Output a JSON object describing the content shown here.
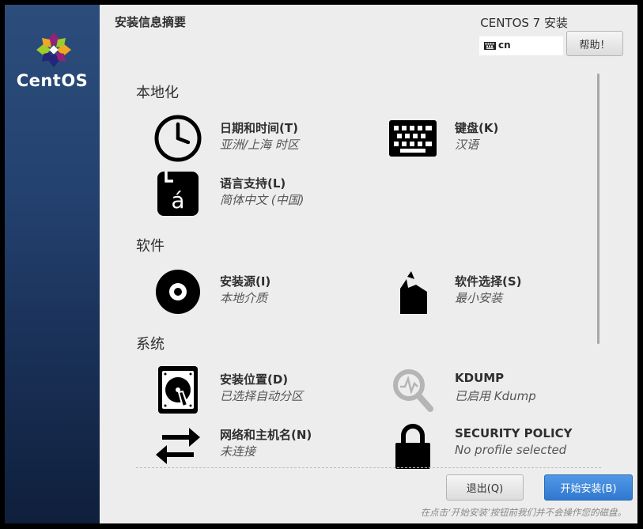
{
  "brand": {
    "name": "CentOS"
  },
  "header": {
    "title": "安装信息摘要",
    "install_title": "CENTOS 7 安装",
    "keyboard_layout": "cn",
    "help_label": "帮助！"
  },
  "sections": {
    "localization": "本地化",
    "software": "软件",
    "system": "系统"
  },
  "spokes": {
    "datetime": {
      "title": "日期和时间(T)",
      "status": "亚洲/上海 时区"
    },
    "keyboard": {
      "title": "键盘(K)",
      "status": "汉语"
    },
    "language": {
      "title": "语言支持(L)",
      "status": "简体中文 (中国)"
    },
    "source": {
      "title": "安装源(I)",
      "status": "本地介质"
    },
    "software_selection": {
      "title": "软件选择(S)",
      "status": "最小安装"
    },
    "destination": {
      "title": "安装位置(D)",
      "status": "已选择自动分区"
    },
    "kdump": {
      "title": "KDUMP",
      "status": "已启用 Kdump"
    },
    "network": {
      "title": "网络和主机名(N)",
      "status": "未连接"
    },
    "security": {
      "title": "SECURITY POLICY",
      "status": "No profile selected"
    }
  },
  "footer": {
    "quit_label": "退出(Q)",
    "begin_label": "开始安装(B)",
    "note": "在点击‘开始安装’按钮前我们并不会操作您的磁盘。"
  },
  "colors": {
    "sidebar": "#244270",
    "primary_button": "#3a83d8",
    "background": "#ededed"
  }
}
